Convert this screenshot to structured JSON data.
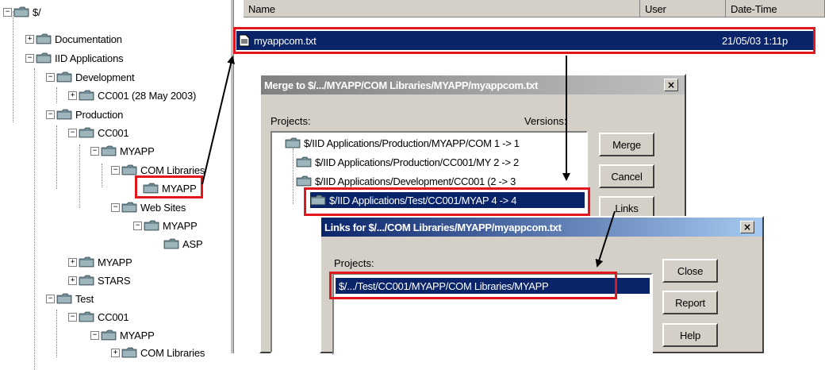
{
  "tree": {
    "root": "$/",
    "documentation": "Documentation",
    "iid_applications": "IID Applications",
    "development": "Development",
    "cc001_dev": "CC001 (28 May 2003)",
    "production": "Production",
    "cc001_prod": "CC001",
    "myapp_prod": "MYAPP",
    "com_libraries": "COM Libraries",
    "myapp_selected": "MYAPP",
    "web_sites": "Web Sites",
    "myapp_web": "MYAPP",
    "asp": "ASP",
    "myapp_top": "MYAPP",
    "stars": "STARS",
    "test": "Test",
    "cc001_test": "CC001",
    "myapp_test": "MYAPP",
    "com_libraries_test": "COM Libraries"
  },
  "file_list": {
    "columns": {
      "name": "Name",
      "user": "User",
      "datetime": "Date-Time"
    },
    "row": {
      "name": "myappcom.txt",
      "user": "",
      "datetime": "21/05/03  1:11p"
    }
  },
  "merge_dialog": {
    "title": "Merge to $/.../MYAPP/COM Libraries/MYAPP/myappcom.txt",
    "projects_label": "Projects:",
    "versions_label": "Versions:",
    "items": [
      "$/IID Applications/Production/MYAPP/COM 1 -> 1",
      "$/IID Applications/Production/CC001/MY 2 -> 2",
      "$/IID Applications/Development/CC001 (2 -> 3",
      "$/IID Applications/Test/CC001/MYAP 4 -> 4"
    ],
    "buttons": {
      "merge": "Merge",
      "cancel": "Cancel",
      "links": "Links"
    },
    "close_glyph": "×"
  },
  "links_dialog": {
    "title": "Links for $/.../COM Libraries/MYAPP/myappcom.txt",
    "projects_label": "Projects:",
    "item": "$/.../Test/CC001/MYAPP/COM Libraries/MYAPP",
    "buttons": {
      "close": "Close",
      "report": "Report",
      "help": "Help"
    },
    "close_glyph": "×"
  },
  "colors": {
    "selection": "#0a246a",
    "titlebar_start": "#0a246a",
    "titlebar_end": "#a6caf0",
    "annotation_red": "#e0181e",
    "dialog_face": "#d4d0c8"
  }
}
